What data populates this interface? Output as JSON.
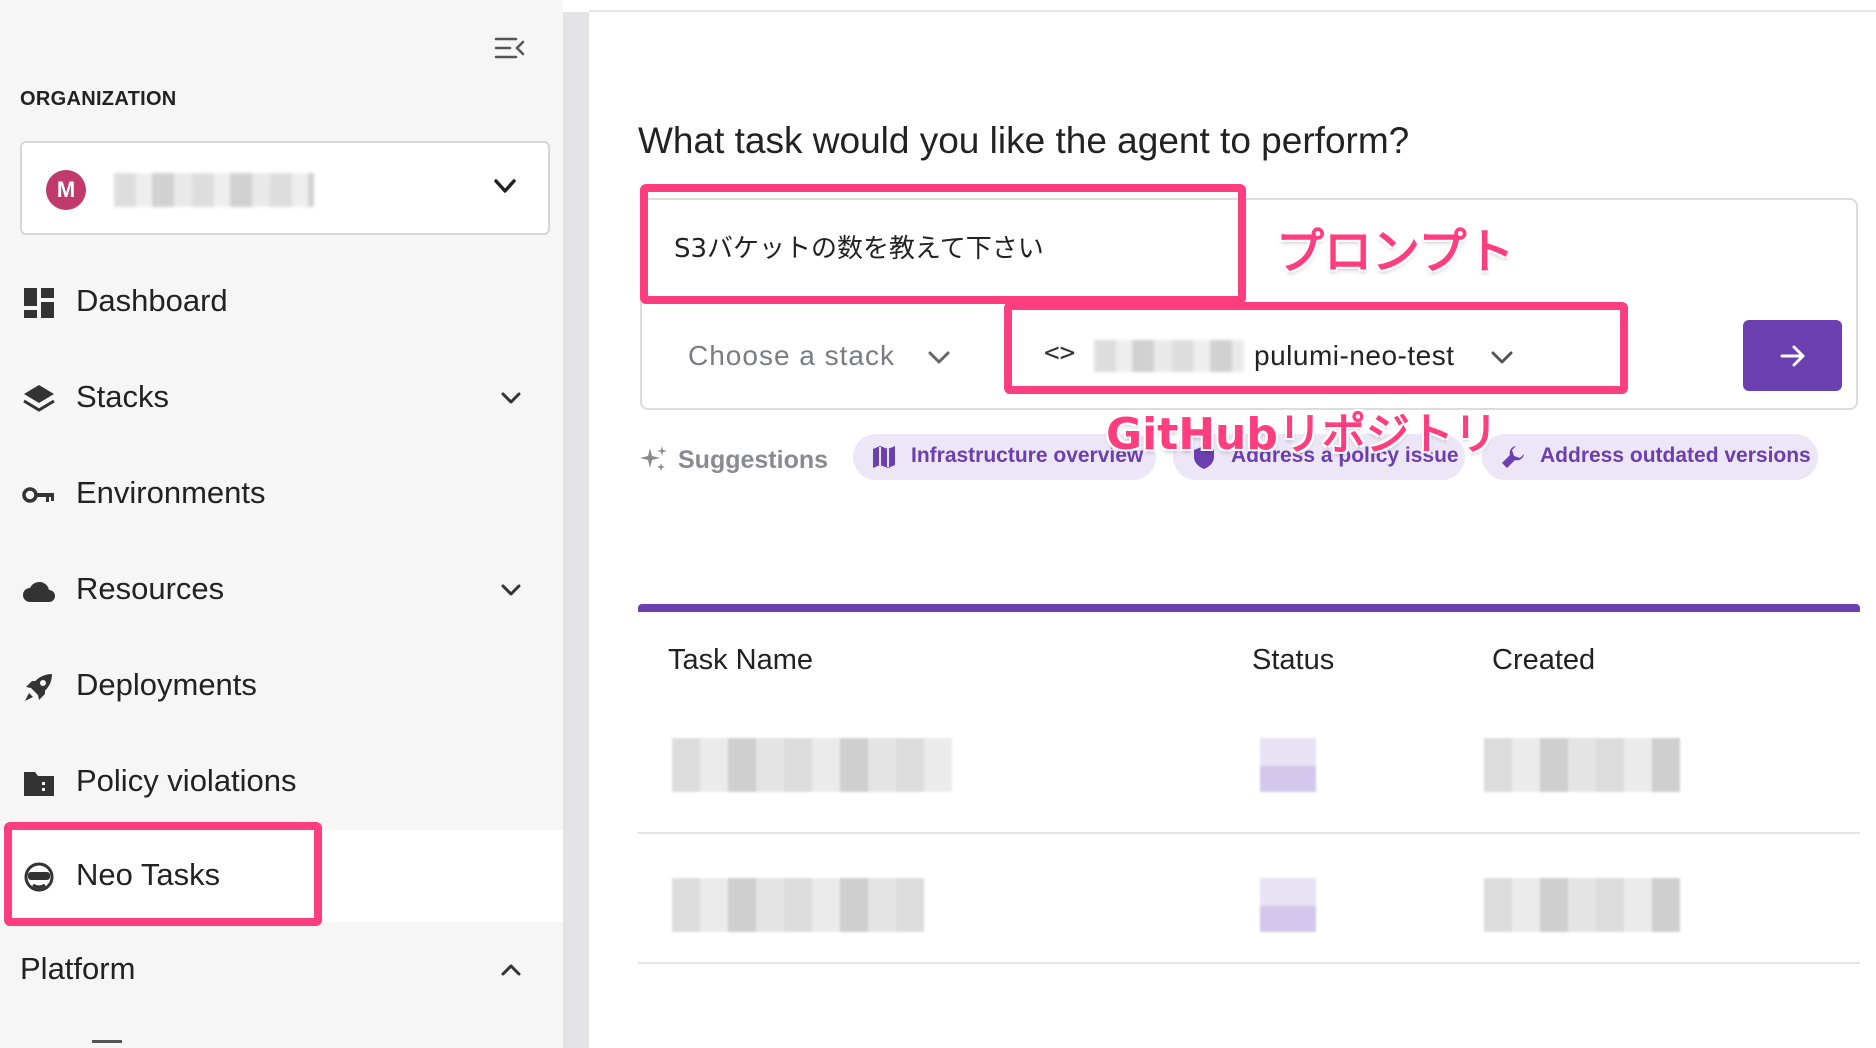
{
  "sidebar": {
    "org_label": "ORGANIZATION",
    "org_avatar_letter": "M",
    "items": [
      {
        "label": "Dashboard",
        "icon": "dashboard-icon"
      },
      {
        "label": "Stacks",
        "icon": "layers-icon"
      },
      {
        "label": "Environments",
        "icon": "key-icon"
      },
      {
        "label": "Resources",
        "icon": "cloud-icon"
      },
      {
        "label": "Deployments",
        "icon": "rocket-icon"
      },
      {
        "label": "Policy violations",
        "icon": "folder-policy-icon"
      },
      {
        "label": "Neo Tasks",
        "icon": "neo-agent-icon",
        "active": true
      }
    ],
    "section_platform": "Platform"
  },
  "main": {
    "question": "What task would you like the agent to perform?",
    "prompt_value": "S3バケットの数を教えて下さい",
    "stack_placeholder": "Choose a stack",
    "repo_code_icon": "<>",
    "repo_name": "pulumi-neo-test",
    "suggestions_label": "Suggestions",
    "suggestions": [
      {
        "label": "Infrastructure overview",
        "icon": "map-icon"
      },
      {
        "label": "Address a policy issue",
        "icon": "shield-icon"
      },
      {
        "label": "Address outdated versions",
        "icon": "wrench-icon"
      }
    ],
    "table": {
      "columns": [
        "Task Name",
        "Status",
        "Created"
      ]
    }
  },
  "annotations": {
    "prompt": "プロンプト",
    "repo": "GitHubリポジトリ"
  },
  "colors": {
    "accent": "#6b3fb0",
    "highlight": "#ff3d7f",
    "avatar": "#c13a6c"
  }
}
